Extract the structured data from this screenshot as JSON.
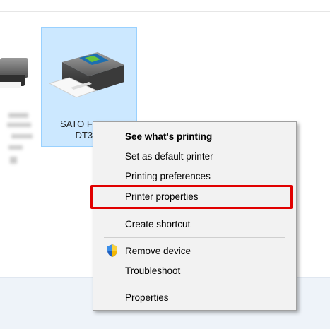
{
  "device": {
    "name_line1": "SATO FX3-LX",
    "name_line2": "DT305"
  },
  "context_menu": {
    "items": [
      {
        "label": "See what's printing",
        "bold": true
      },
      {
        "label": "Set as default printer"
      },
      {
        "label": "Printing preferences"
      },
      {
        "label": "Printer properties",
        "highlighted": true
      },
      {
        "label": "Create shortcut"
      },
      {
        "label": "Remove device",
        "icon": "shield-icon"
      },
      {
        "label": "Troubleshoot"
      },
      {
        "label": "Properties"
      }
    ]
  },
  "colors": {
    "selection_fill": "#cce8ff",
    "menu_background": "#f2f2f2",
    "highlight_border": "#e10000"
  }
}
